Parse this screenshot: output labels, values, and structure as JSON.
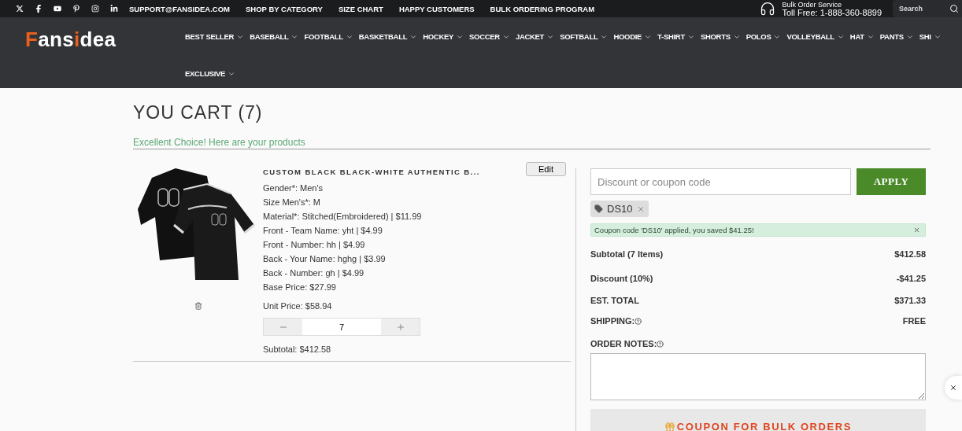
{
  "top_bar": {
    "social": [
      {
        "kind": "x"
      },
      {
        "kind": "facebook"
      },
      {
        "kind": "youtube"
      },
      {
        "kind": "pinterest"
      },
      {
        "kind": "instagram"
      },
      {
        "kind": "linkedin"
      }
    ],
    "links": [
      "SUPPORT@FANSIDEA.COM",
      "SHOP BY CATEGORY",
      "SIZE CHART",
      "HAPPY CUSTOMERS",
      "BULK ORDERING PROGRAM"
    ],
    "service_title": "Bulk Order Service",
    "service_phone": "Toll Free: 1-888-360-8899",
    "search": {
      "placeholder": "Search"
    }
  },
  "logo": {
    "text": "Fansidea"
  },
  "nav": [
    "BEST SELLER",
    "BASEBALL",
    "FOOTBALL",
    "BASKETBALL",
    "HOCKEY",
    "SOCCER",
    "JACKET",
    "SOFTBALL",
    "HOODIE",
    "T-SHIRT",
    "SHORTS",
    "POLOS",
    "VOLLEYBALL",
    "HAT",
    "PANTS",
    "SHI",
    "EXCLUSIVE"
  ],
  "cart": {
    "title": "YOU CART (7)",
    "subtitle": "Excellent Choice! Here are your products",
    "item": {
      "name": "CUSTOM BLACK BLACK-WHITE AUTHENTIC B...",
      "edit": "Edit",
      "options": [
        "Gender*: Men's",
        "Size Men's*: M",
        "Material*: Stitched(Embroidered) | $11.99",
        "Front - Team Name: yht | $4.99",
        "Front - Number: hh | $4.99",
        "Back - Your Name: hghg | $3.99",
        "Back - Number: gh | $4.99",
        "Base Price: $27.99"
      ],
      "unit_price": "Unit Price: $58.94",
      "quantity": "7",
      "subtotal": "Subtotal: $412.58"
    }
  },
  "summary": {
    "coupon": {
      "placeholder": "Discount or coupon code"
    },
    "apply": "APPLY",
    "tag": "DS10",
    "notice": "Coupon code 'DS10' applied, you saved $41.25!",
    "rows": [
      {
        "label": "Subtotal (7 Items)",
        "value": "$412.58"
      },
      {
        "label": "Discount (10%)",
        "value": "-$41.25"
      },
      {
        "label": "EST. TOTAL",
        "value": "$371.33"
      },
      {
        "label": "SHIPPING:",
        "value": "FREE",
        "help": true
      }
    ],
    "notes_label": "ORDER NOTES:",
    "bulk": "COUPON FOR BULK ORDERS"
  }
}
